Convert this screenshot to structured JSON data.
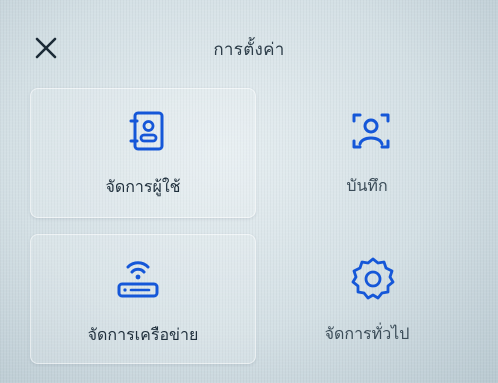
{
  "header": {
    "title": "การตั้งค่า",
    "close_icon": "close-icon"
  },
  "tiles": [
    {
      "label": "จัดการผู้ใช้",
      "icon": "contacts-book-icon",
      "style": "card"
    },
    {
      "label": "บันทึก",
      "icon": "face-scan-icon",
      "style": "plain"
    },
    {
      "label": "จัดการเครือข่าย",
      "icon": "wifi-router-icon",
      "style": "card"
    },
    {
      "label": "จัดการทั่วไป",
      "icon": "gear-icon",
      "style": "plain"
    }
  ],
  "colors": {
    "icon_blue": "#1557d8",
    "text": "#1f2f3c",
    "background": "#d9e4e8"
  }
}
